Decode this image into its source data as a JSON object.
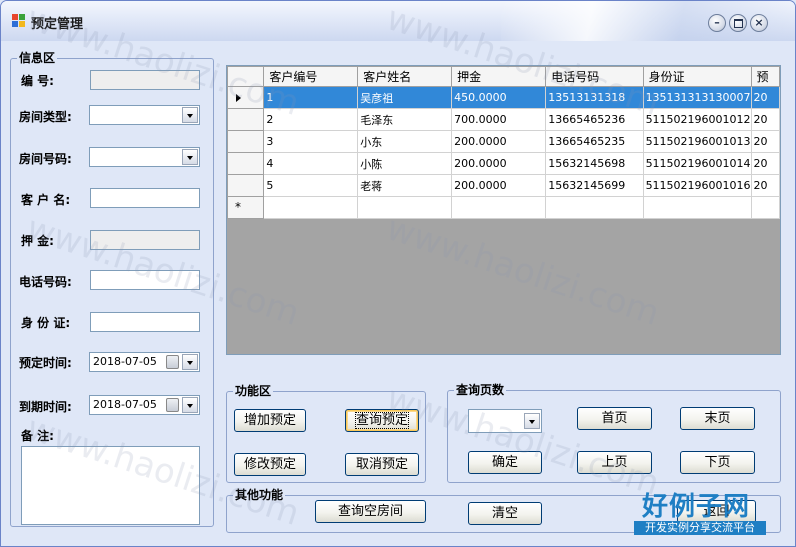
{
  "window": {
    "title": "预定管理"
  },
  "info": {
    "legend": "信息区",
    "fields": {
      "number": {
        "label": "编    号:",
        "value": ""
      },
      "room_type": {
        "label": "房间类型:",
        "value": ""
      },
      "room_number": {
        "label": "房间号码:",
        "value": ""
      },
      "customer_name": {
        "label": "客 户 名:",
        "value": ""
      },
      "deposit": {
        "label": "押    金:",
        "value": ""
      },
      "phone": {
        "label": "电话号码:",
        "value": ""
      },
      "id_card": {
        "label": "身 份 证:",
        "value": ""
      },
      "reserve_time": {
        "label": "预定时间:",
        "value": "2018-07-05"
      },
      "expire_time": {
        "label": "到期时间:",
        "value": "2018-07-05"
      },
      "note": {
        "label": "备    注:",
        "value": ""
      }
    }
  },
  "grid": {
    "headers": [
      "客户编号",
      "客户姓名",
      "押金",
      "电话号码",
      "身份证",
      "预"
    ],
    "rows": [
      [
        "1",
        "吴彦祖",
        "450.0000",
        "13513131318",
        "135131313130007",
        "20"
      ],
      [
        "2",
        "毛泽东",
        "700.0000",
        "13665465236",
        "511502196001012",
        "20"
      ],
      [
        "3",
        "小东",
        "200.0000",
        "13665465235",
        "511502196001013",
        "20"
      ],
      [
        "4",
        "小陈",
        "200.0000",
        "15632145698",
        "511502196001014",
        "20"
      ],
      [
        "5",
        "老蒋",
        "200.0000",
        "15632145699",
        "511502196001016",
        "20"
      ]
    ],
    "selected_row": 0,
    "new_row_marker": "*"
  },
  "functions": {
    "legend": "功能区",
    "add_label": "增加预定",
    "query_label": "查询预定",
    "modify_label": "修改预定",
    "cancel_label": "取消预定"
  },
  "paging": {
    "legend": "查询页数",
    "page_select_value": "",
    "first_label": "首页",
    "last_label": "末页",
    "confirm_label": "确定",
    "prev_label": "上页",
    "next_label": "下页"
  },
  "other": {
    "legend": "其他功能",
    "query_empty_rooms_label": "查询空房间",
    "clear_label": "清空",
    "back_label": "返回"
  },
  "watermark": {
    "text": "www.haolizi.com",
    "logo_main": "好例子网",
    "logo_sub": "开发实例分享交流平台"
  },
  "colors": {
    "selection": "#3188d8",
    "window_bg": "#dfe7f7",
    "grid_empty": "#a4a4a4",
    "logo": "#1f7fc4"
  }
}
